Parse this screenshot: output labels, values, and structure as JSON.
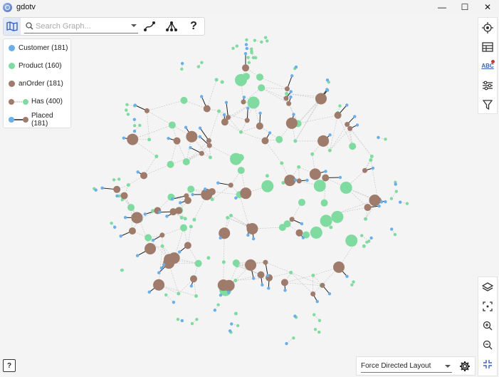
{
  "window": {
    "title": "gdotv",
    "minimize_glyph": "—",
    "maximize_glyph": "☐",
    "close_glyph": "✕"
  },
  "toolbar": {
    "map_icon": "map-icon",
    "search_placeholder": "Search Graph...",
    "path_icon": "path-icon",
    "hierarchy_icon": "hierarchy-icon",
    "help_label": "?"
  },
  "legend": {
    "items": [
      {
        "kind": "node",
        "label": "Customer (181)",
        "color": "#6aaeea"
      },
      {
        "kind": "node",
        "label": "Product (160)",
        "color": "#7fdba0"
      },
      {
        "kind": "node",
        "label": "anOrder (181)",
        "color": "#9e7b6b"
      },
      {
        "kind": "edge",
        "label": "Has (400)",
        "from": "#9e7b6b",
        "to": "#7fdba0"
      },
      {
        "kind": "edge",
        "label": "Placed (181)",
        "from": "#6aaeea",
        "to": "#9e7b6b"
      }
    ]
  },
  "right_toolbar_top": [
    "target-icon",
    "table-icon",
    "abc-icon",
    "sliders-icon",
    "filter-icon"
  ],
  "abc_label": "ABC",
  "right_toolbar_bottom": [
    "layers-icon",
    "focus-icon",
    "zoom-in-icon",
    "zoom-out-icon",
    "collapse-icon"
  ],
  "layout": {
    "selected": "Force Directed Layout",
    "settings_icon": "gear-icon"
  },
  "help_corner_label": "?",
  "colors": {
    "customer": "#6aaeea",
    "product": "#7fdba0",
    "order": "#9e7b6b",
    "accent": "#3b62b8"
  }
}
